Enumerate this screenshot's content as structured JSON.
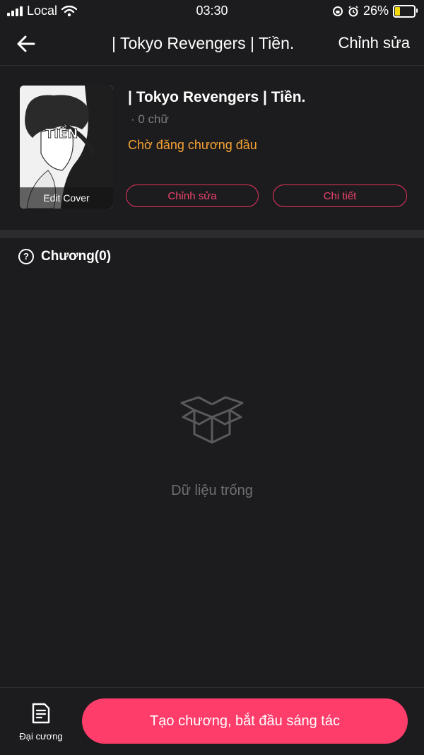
{
  "status_bar": {
    "carrier": "Local",
    "time": "03:30",
    "battery_percent": "26%",
    "battery_level": 0.26,
    "icons": [
      "signal-icon",
      "wifi-icon",
      "rotation-lock-icon",
      "alarm-icon",
      "battery-charging-icon"
    ]
  },
  "nav": {
    "title": "| Tokyo Revengers | Tiền.",
    "edit_label": "Chỉnh sửa",
    "back_icon": "arrow-left-icon"
  },
  "book": {
    "cover_text": "TIỀN",
    "cover_caption": "Edit Cover",
    "title": "| Tokyo Revengers | Tiền.",
    "word_count": "· 0 chữ",
    "status": "Chờ đăng chương đầu",
    "edit_button": "Chỉnh sửa",
    "detail_button": "Chi tiết"
  },
  "chapters": {
    "heading": "Chương(0)",
    "help_icon": "question-circle-icon"
  },
  "empty_state": {
    "icon": "empty-box-icon",
    "text": "Dữ liệu trống"
  },
  "bottom_bar": {
    "outline_label": "Đại cương",
    "outline_icon": "document-icon",
    "create_button": "Tạo chương, bắt đầu sáng tác"
  },
  "colors": {
    "background": "#1c1c1e",
    "accent": "#ff3d6b",
    "status_orange": "#f7a233"
  }
}
